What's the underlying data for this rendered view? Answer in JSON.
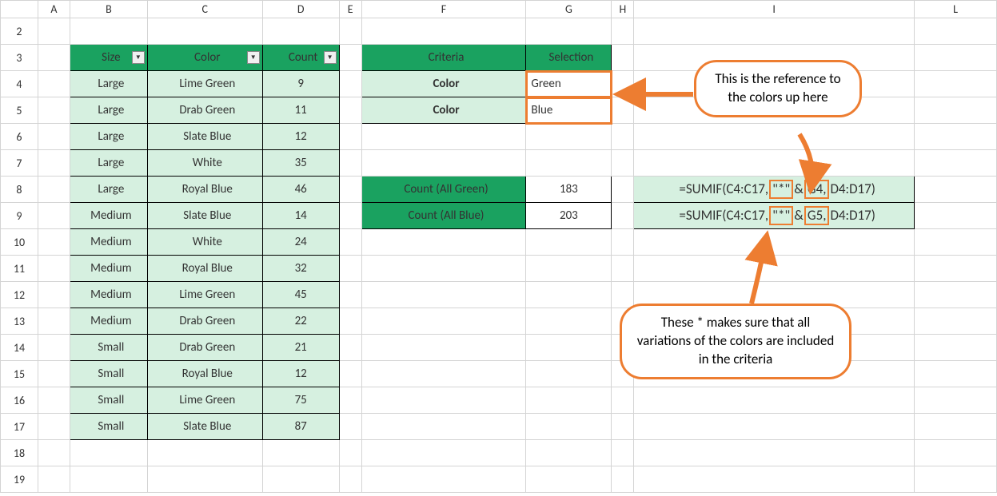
{
  "columns": [
    "A",
    "B",
    "C",
    "D",
    "E",
    "F",
    "G",
    "H",
    "I",
    "L"
  ],
  "rows": [
    "2",
    "3",
    "4",
    "5",
    "6",
    "7",
    "8",
    "9",
    "10",
    "11",
    "12",
    "13",
    "14",
    "15",
    "16",
    "17",
    "18",
    "19"
  ],
  "table1": {
    "headers": {
      "size": "Size",
      "color": "Color",
      "count": "Count"
    },
    "rows": [
      {
        "size": "Large",
        "color": "Lime Green",
        "count": "9"
      },
      {
        "size": "Large",
        "color": "Drab Green",
        "count": "11"
      },
      {
        "size": "Large",
        "color": "Slate Blue",
        "count": "12"
      },
      {
        "size": "Large",
        "color": "White",
        "count": "35"
      },
      {
        "size": "Large",
        "color": "Royal Blue",
        "count": "46"
      },
      {
        "size": "Medium",
        "color": "Slate Blue",
        "count": "14"
      },
      {
        "size": "Medium",
        "color": "White",
        "count": "24"
      },
      {
        "size": "Medium",
        "color": "Royal Blue",
        "count": "32"
      },
      {
        "size": "Medium",
        "color": "Lime Green",
        "count": "45"
      },
      {
        "size": "Medium",
        "color": "Drab Green",
        "count": "22"
      },
      {
        "size": "Small",
        "color": "Drab Green",
        "count": "21"
      },
      {
        "size": "Small",
        "color": "Royal Blue",
        "count": "12"
      },
      {
        "size": "Small",
        "color": "Lime Green",
        "count": "75"
      },
      {
        "size": "Small",
        "color": "Slate Blue",
        "count": "87"
      }
    ]
  },
  "criteria": {
    "headers": {
      "criteria": "Criteria",
      "selection": "Selection"
    },
    "rows": [
      {
        "criteria": "Color",
        "selection": "Green"
      },
      {
        "criteria": "Color",
        "selection": "Blue"
      }
    ]
  },
  "counts": {
    "green_label": "Count (All Green)",
    "green_value": "183",
    "blue_label": "Count (All Blue)",
    "blue_value": "203"
  },
  "formulas": {
    "f1": {
      "pre": "=SUMIF(C4:C17,",
      "star": "\"*\"",
      "amp": "&",
      "ref": "G4,",
      "post": "D4:D17)"
    },
    "f2": {
      "pre": "=SUMIF(C4:C17,",
      "star": "\"*\"",
      "amp": "&",
      "ref": "G5,",
      "post": "D4:D17)"
    }
  },
  "callouts": {
    "top": "This is the reference to the colors up here",
    "bottom": "These * makes sure that all variations of the colors are included in the criteria"
  }
}
